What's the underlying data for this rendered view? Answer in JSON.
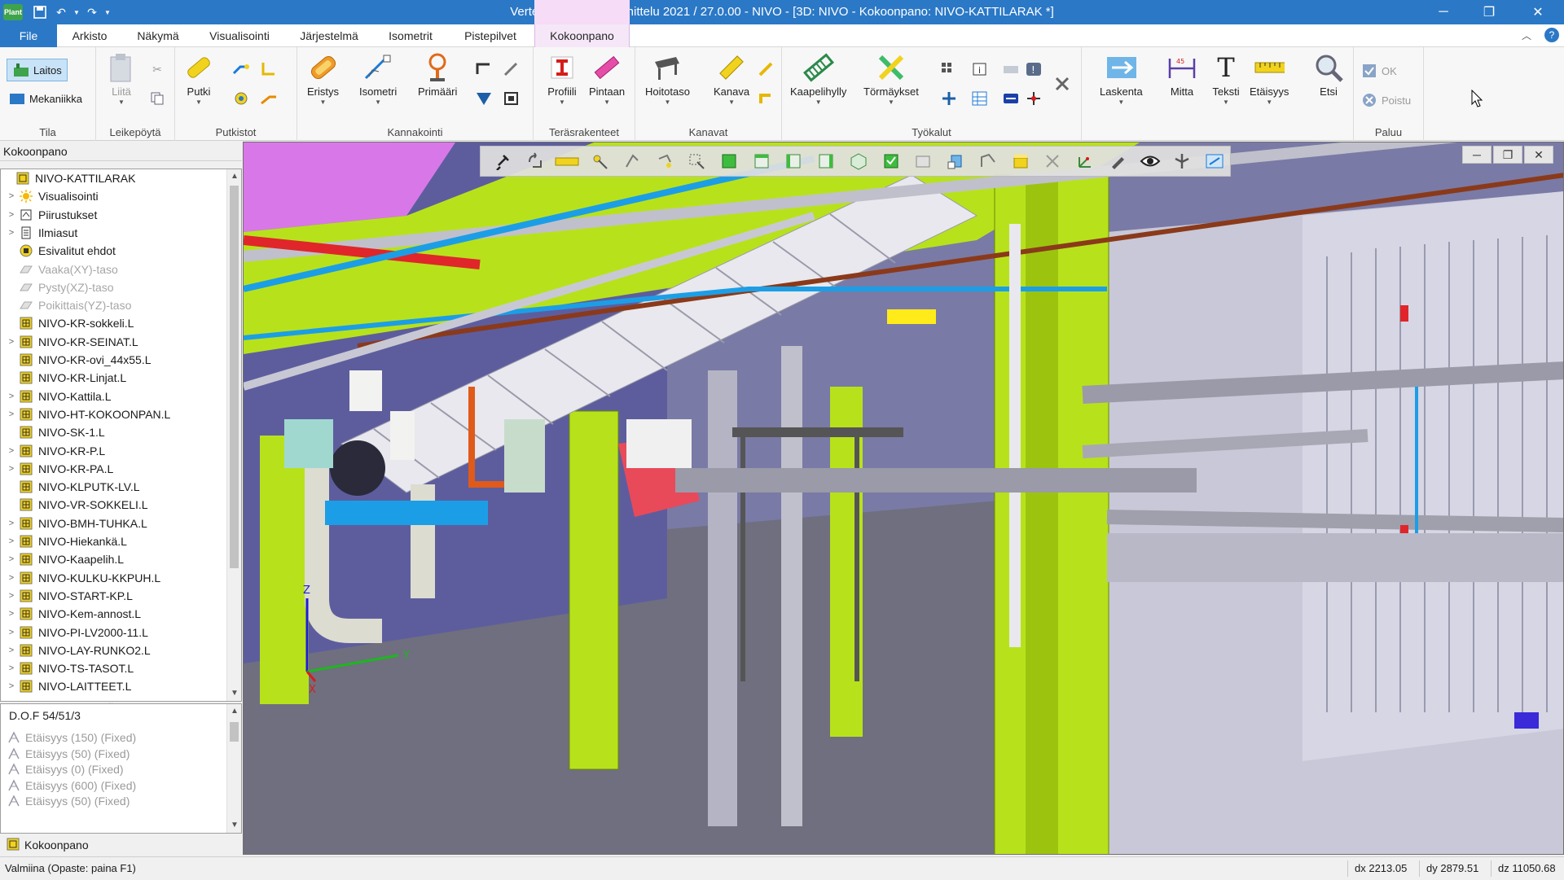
{
  "window": {
    "title": "Vertex G4 Laitossuunnittelu 2021 / 27.0.00 - NIVO - [3D: NIVO - Kokoonpano: NIVO-KATTILARAK *]",
    "app_logo": "Plant",
    "controls": [
      "minimize",
      "restore",
      "close"
    ]
  },
  "tabs": [
    {
      "label": "File",
      "active": false
    },
    {
      "label": "Arkisto"
    },
    {
      "label": "Näkymä"
    },
    {
      "label": "Visualisointi"
    },
    {
      "label": "Järjestelmä"
    },
    {
      "label": "Isometrit"
    },
    {
      "label": "Pistepilvet"
    },
    {
      "label": "Kokoonpano",
      "active": true
    }
  ],
  "ribbon": {
    "tila": {
      "label": "Tila",
      "laitos": "Laitos",
      "mekaniikka": "Mekaniikka"
    },
    "leikepoyta": {
      "label": "Leikepöytä",
      "liita": "Liitä"
    },
    "putkistot": {
      "label": "Putkistot",
      "putki": "Putki"
    },
    "kannakointi": {
      "label": "Kannakointi",
      "eristys": "Eristys",
      "isometri": "Isometri",
      "primaari": "Primääri"
    },
    "terasrakenteet": {
      "label": "Teräsrakenteet",
      "profiili": "Profiili",
      "pintaan": "Pintaan"
    },
    "kanavat": {
      "label": "Kanavat",
      "hoitotaso": "Hoitotaso",
      "kanava": "Kanava"
    },
    "tyokalut": {
      "label": "Työkalut",
      "kaapelihylly": "Kaapelihylly",
      "tormaykset": "Törmäykset"
    },
    "misc": {
      "laskenta": "Laskenta",
      "mitta": "Mitta",
      "teksti": "Teksti",
      "etaisyys": "Etäisyys",
      "etsi": "Etsi"
    },
    "paluu": {
      "label": "Paluu",
      "ok": "OK",
      "poistu": "Poistu"
    }
  },
  "panel": {
    "header": "Kokoonpano",
    "tree": [
      {
        "label": "NIVO-KATTILARAK",
        "indent": 0,
        "exp": "",
        "icon": "assembly",
        "grey": false
      },
      {
        "label": "Visualisointi",
        "indent": 1,
        "exp": ">",
        "icon": "sun",
        "grey": false
      },
      {
        "label": "Piirustukset",
        "indent": 1,
        "exp": ">",
        "icon": "drawing",
        "grey": false
      },
      {
        "label": "Ilmiasut",
        "indent": 1,
        "exp": ">",
        "icon": "list",
        "grey": false
      },
      {
        "label": "Esivalitut ehdot",
        "indent": 1,
        "exp": "",
        "icon": "filter",
        "grey": false
      },
      {
        "label": "Vaaka(XY)-taso",
        "indent": 1,
        "exp": "",
        "icon": "plane",
        "grey": true
      },
      {
        "label": "Pysty(XZ)-taso",
        "indent": 1,
        "exp": "",
        "icon": "plane",
        "grey": true
      },
      {
        "label": "Poikittais(YZ)-taso",
        "indent": 1,
        "exp": "",
        "icon": "plane",
        "grey": true
      },
      {
        "label": "NIVO-KR-sokkeli.L",
        "indent": 1,
        "exp": "",
        "icon": "part",
        "grey": false
      },
      {
        "label": "NIVO-KR-SEINAT.L",
        "indent": 1,
        "exp": ">",
        "icon": "part",
        "grey": false
      },
      {
        "label": "NIVO-KR-ovi_44x55.L",
        "indent": 1,
        "exp": "",
        "icon": "part",
        "grey": false
      },
      {
        "label": "NIVO-KR-Linjat.L",
        "indent": 1,
        "exp": "",
        "icon": "part",
        "grey": false
      },
      {
        "label": "NIVO-Kattila.L",
        "indent": 1,
        "exp": ">",
        "icon": "part",
        "grey": false
      },
      {
        "label": "NIVO-HT-KOKOONPAN.L",
        "indent": 1,
        "exp": ">",
        "icon": "part",
        "grey": false
      },
      {
        "label": "NIVO-SK-1.L",
        "indent": 1,
        "exp": "",
        "icon": "part",
        "grey": false
      },
      {
        "label": "NIVO-KR-P.L",
        "indent": 1,
        "exp": ">",
        "icon": "part",
        "grey": false
      },
      {
        "label": "NIVO-KR-PA.L",
        "indent": 1,
        "exp": ">",
        "icon": "part",
        "grey": false
      },
      {
        "label": "NIVO-KLPUTK-LV.L",
        "indent": 1,
        "exp": "",
        "icon": "part",
        "grey": false
      },
      {
        "label": "NIVO-VR-SOKKELI.L",
        "indent": 1,
        "exp": "",
        "icon": "part",
        "grey": false
      },
      {
        "label": "NIVO-BMH-TUHKA.L",
        "indent": 1,
        "exp": ">",
        "icon": "part",
        "grey": false
      },
      {
        "label": "NIVO-Hiekankä.L",
        "indent": 1,
        "exp": ">",
        "icon": "part",
        "grey": false
      },
      {
        "label": "NIVO-Kaapelih.L",
        "indent": 1,
        "exp": ">",
        "icon": "part",
        "grey": false
      },
      {
        "label": "NIVO-KULKU-KKPUH.L",
        "indent": 1,
        "exp": ">",
        "icon": "part",
        "grey": false
      },
      {
        "label": "NIVO-START-KP.L",
        "indent": 1,
        "exp": ">",
        "icon": "part",
        "grey": false
      },
      {
        "label": "NIVO-Kem-annost.L",
        "indent": 1,
        "exp": ">",
        "icon": "part",
        "grey": false
      },
      {
        "label": "NIVO-PI-LV2000-11.L",
        "indent": 1,
        "exp": ">",
        "icon": "part",
        "grey": false
      },
      {
        "label": "NIVO-LAY-RUNKO2.L",
        "indent": 1,
        "exp": ">",
        "icon": "part",
        "grey": false
      },
      {
        "label": "NIVO-TS-TASOT.L",
        "indent": 1,
        "exp": ">",
        "icon": "part",
        "grey": false
      },
      {
        "label": "NIVO-LAITTEET.L",
        "indent": 1,
        "exp": ">",
        "icon": "part",
        "grey": false
      }
    ],
    "dof": {
      "title": "D.O.F  54/51/3",
      "rows": [
        "Etäisyys (150) (Fixed)",
        "Etäisyys (50) (Fixed)",
        "Etäisyys (0) (Fixed)",
        "Etäisyys (600) (Fixed)",
        "Etäisyys (50) (Fixed)"
      ]
    },
    "bottom_tab": "Kokoonpano"
  },
  "viewport": {
    "axis_labels": {
      "z": "Z",
      "y": "Y",
      "x": "X"
    },
    "colors": {
      "floor": "#6f6f7f",
      "green": "#b7e21b",
      "blue": "#1c9ee6",
      "grey": "#c8c8d4",
      "red": "#e0262a"
    }
  },
  "status": {
    "text": "Valmiina (Opaste: paina F1)",
    "dx": "dx 2213.05",
    "dy": "dy 2879.51",
    "dz": "dz 11050.68"
  }
}
